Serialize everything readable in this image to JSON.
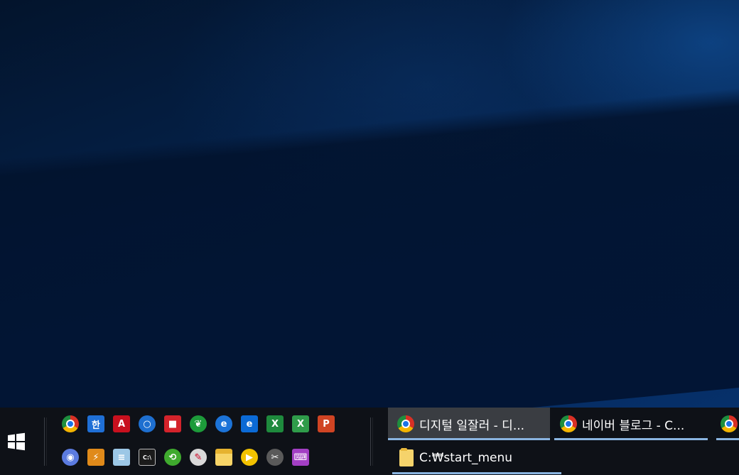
{
  "desktop": {
    "name": "desktop"
  },
  "taskbar": {
    "start_label": "",
    "quick_launch_row1": [
      {
        "name": "chrome-icon",
        "glyph": "",
        "bg": "conic-gradient(#d93025 0deg 120deg,#f4b400 120deg 240deg,#1e8e3e 240deg 360deg)",
        "round": true,
        "inner": "#1a73e8"
      },
      {
        "name": "hangul-word-icon",
        "glyph": "한",
        "bg": "#1f6fd6",
        "round": false
      },
      {
        "name": "acrobat-reader-icon",
        "glyph": "A",
        "bg": "#c8101e",
        "round": false
      },
      {
        "name": "cortana-circle-icon",
        "glyph": "○",
        "bg": "#1e6fd0",
        "round": true
      },
      {
        "name": "red-book-icon",
        "glyph": "■",
        "bg": "#d4232b",
        "round": false
      },
      {
        "name": "evernote-icon",
        "glyph": "❦",
        "bg": "#1d9b3a",
        "round": true
      },
      {
        "name": "internet-explorer-icon",
        "glyph": "e",
        "bg": "#1c73d8",
        "round": true
      },
      {
        "name": "edge-icon",
        "glyph": "e",
        "bg": "#0b6ad6",
        "round": false
      },
      {
        "name": "excel-icon",
        "glyph": "X",
        "bg": "#1e8a3d",
        "round": false
      },
      {
        "name": "excel-2-icon",
        "glyph": "X",
        "bg": "#2f9c4a",
        "round": false
      },
      {
        "name": "powerpoint-icon",
        "glyph": "P",
        "bg": "#d04423",
        "round": false
      }
    ],
    "quick_launch_row2": [
      {
        "name": "camera-icon",
        "glyph": "◉",
        "bg": "#5b7be0",
        "round": true
      },
      {
        "name": "thunder-tool-icon",
        "glyph": "⚡",
        "bg": "#e08a1a",
        "round": false
      },
      {
        "name": "notepad-icon",
        "glyph": "≡",
        "bg": "#9cc7e6",
        "round": false
      },
      {
        "name": "command-prompt-icon",
        "glyph": "C:\\",
        "bg": "#1b1b1b",
        "round": false
      },
      {
        "name": "sync-share-icon",
        "glyph": "⟲",
        "bg": "#3faa2e",
        "round": true
      },
      {
        "name": "paint-icon",
        "glyph": "✎",
        "bg": "#d9d9d9",
        "round": true
      },
      {
        "name": "file-explorer-icon",
        "glyph": "",
        "bg": "#f3c544",
        "round": false
      },
      {
        "name": "media-player-icon",
        "glyph": "▶",
        "bg": "#f2c200",
        "round": true
      },
      {
        "name": "snipping-tool-icon",
        "glyph": "✂",
        "bg": "#5a5a5a",
        "round": true
      },
      {
        "name": "on-screen-keyboard-icon",
        "glyph": "⌨",
        "bg": "#a33fc4",
        "round": false
      }
    ],
    "tasks_row1": [
      {
        "name": "task-chrome-digital",
        "label": "디지털 일잘러 - 디...",
        "active": true
      },
      {
        "name": "task-chrome-naver",
        "label": "네이버 블로그 - C...",
        "active": false
      },
      {
        "name": "task-chrome-3",
        "label": "",
        "active": false
      }
    ],
    "tasks_row2": [
      {
        "name": "task-explorer-start-menu",
        "label": "C:₩start_menu",
        "active": false
      }
    ]
  }
}
